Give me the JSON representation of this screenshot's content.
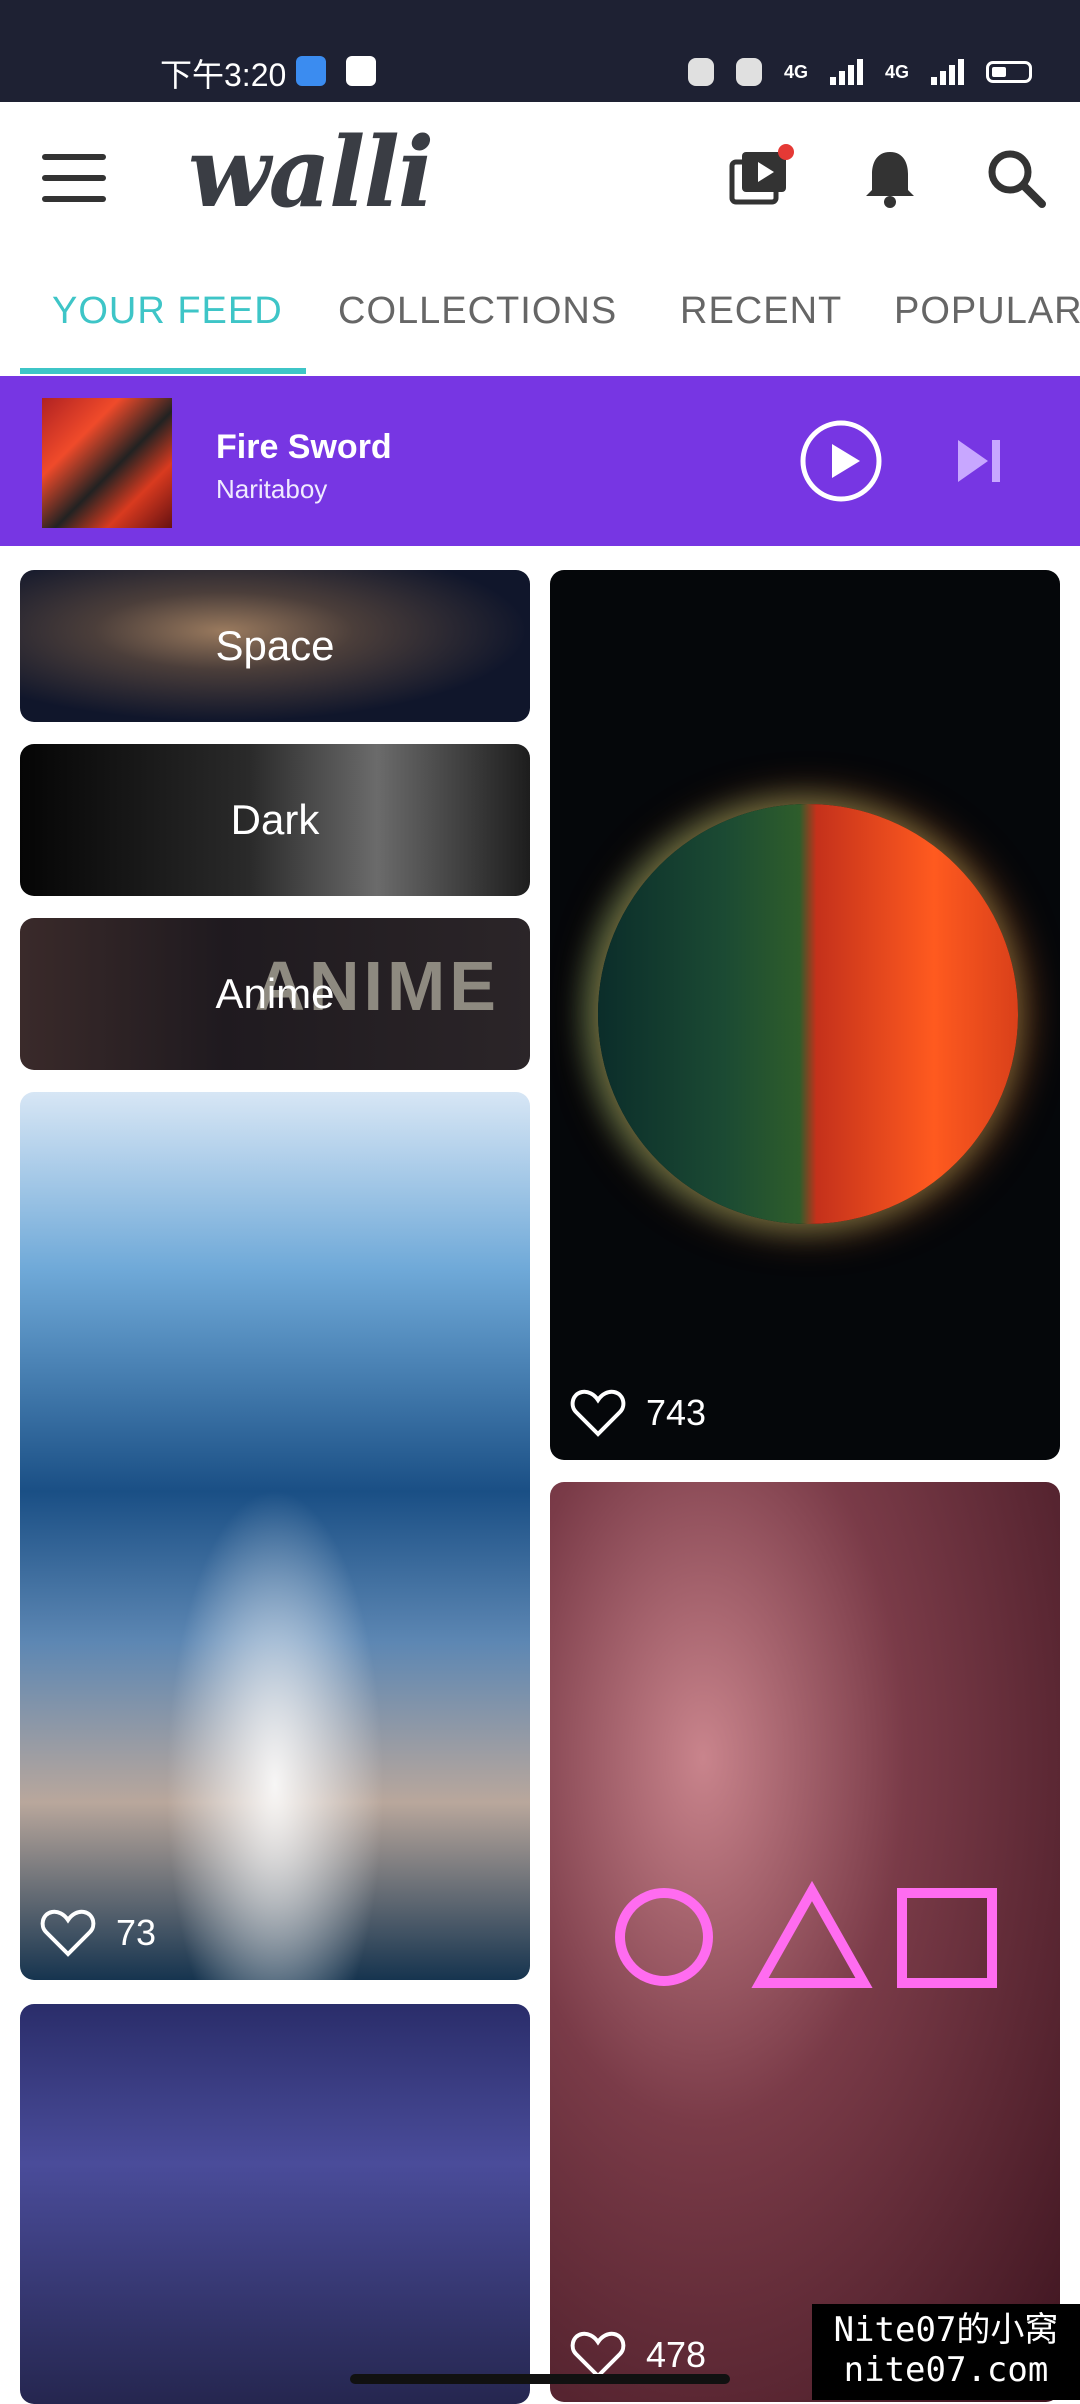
{
  "status_bar": {
    "time": "下午3:20",
    "net_1": "4G",
    "net_2": "4G"
  },
  "app": {
    "logo": "walli"
  },
  "tabs": [
    {
      "label": "YOUR FEED",
      "active": true
    },
    {
      "label": "COLLECTIONS",
      "active": false
    },
    {
      "label": "RECENT",
      "active": false
    },
    {
      "label": "POPULAR",
      "active": false
    }
  ],
  "now_playing": {
    "track": "Fire Sword",
    "artist": "Naritaboy"
  },
  "categories": [
    {
      "label": "Space"
    },
    {
      "label": "Dark"
    },
    {
      "label": "Anime",
      "decor_text": "ANIME"
    }
  ],
  "wallpapers": [
    {
      "likes": "73"
    },
    {
      "likes": "743"
    },
    {
      "likes": "478"
    }
  ],
  "watermark": {
    "line1": "Nite07的小窝",
    "line2": "nite07.com"
  },
  "colors": {
    "accent_teal": "#3ec5c7",
    "player_purple": "#7736e3",
    "status_bar": "#1e2133"
  }
}
